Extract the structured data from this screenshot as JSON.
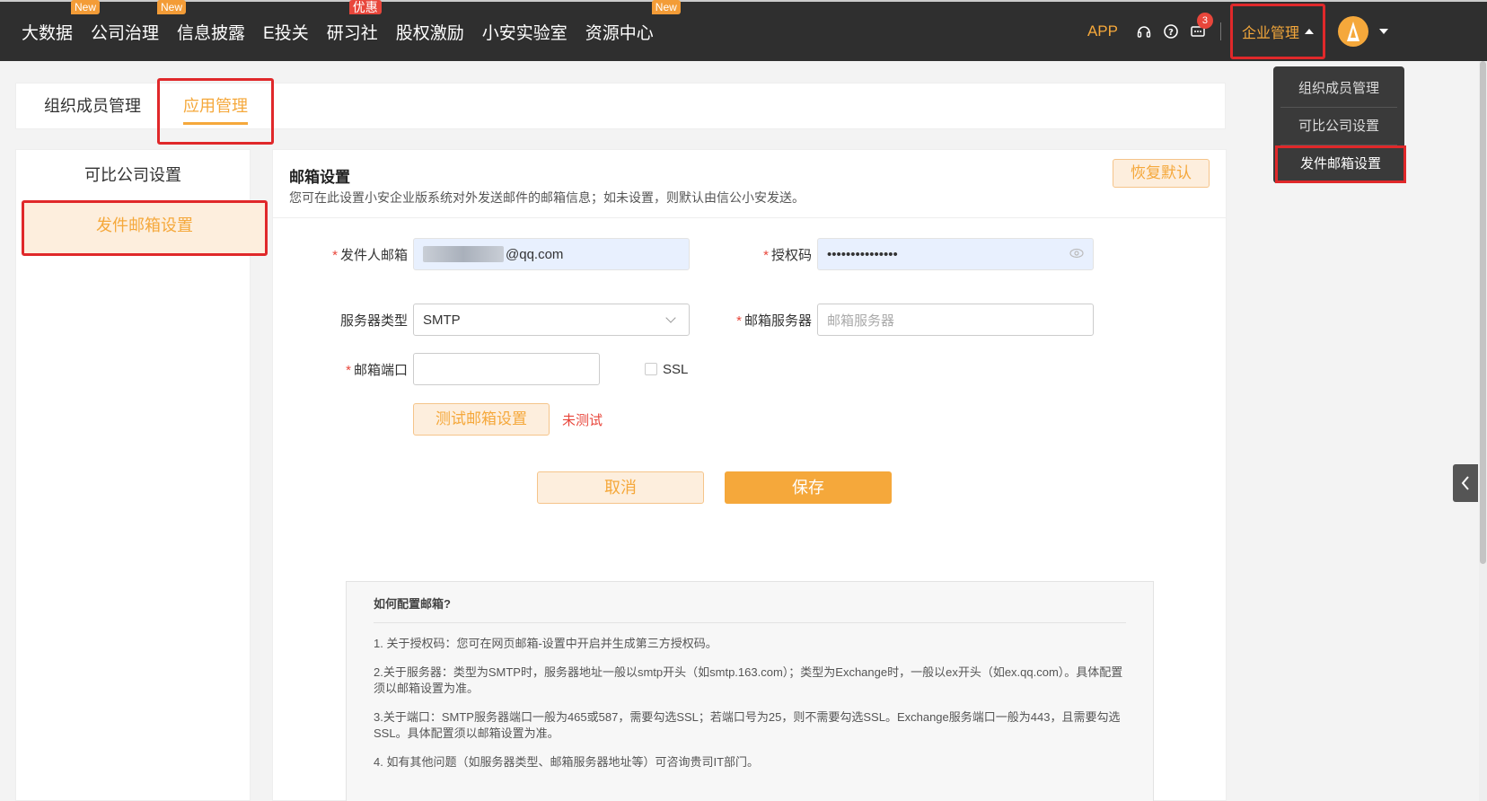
{
  "nav": {
    "items": [
      {
        "label": "大数据",
        "badge": "New"
      },
      {
        "label": "公司治理",
        "badge": "New"
      },
      {
        "label": "信息披露",
        "badge": ""
      },
      {
        "label": "E投关",
        "badge": ""
      },
      {
        "label": "研习社",
        "badge": "优惠"
      },
      {
        "label": "股权激励",
        "badge": ""
      },
      {
        "label": "小安实验室",
        "badge": ""
      },
      {
        "label": "资源中心",
        "badge": "New"
      }
    ],
    "app_label": "APP",
    "message_count": "3",
    "enterprise_menu": "企业管理"
  },
  "dropdown": {
    "items": [
      "组织成员管理",
      "可比公司设置",
      "发件邮箱设置"
    ]
  },
  "tabs": [
    "组织成员管理",
    "应用管理"
  ],
  "sidebar": {
    "items": [
      "可比公司设置",
      "发件邮箱设置"
    ]
  },
  "main": {
    "title": "邮箱设置",
    "description": "您可在此设置小安企业版系统对外发送邮件的邮箱信息；如未设置，则默认由信公小安发送。",
    "restore_label": "恢复默认"
  },
  "form": {
    "sender_label": "发件人邮箱",
    "sender_value": "@qq.com",
    "auth_label": "授权码",
    "auth_value": "•••••••••••••••",
    "server_type_label": "服务器类型",
    "server_type_value": "SMTP",
    "mail_server_label": "邮箱服务器",
    "mail_server_placeholder": "邮箱服务器",
    "port_label": "邮箱端口",
    "port_value": "",
    "ssl_label": "SSL",
    "test_label": "测试邮箱设置",
    "test_status": "未测试",
    "cancel_label": "取消",
    "save_label": "保存"
  },
  "help": {
    "title": "如何配置邮箱?",
    "lines": [
      "1. 关于授权码：您可在网页邮箱-设置中开启并生成第三方授权码。",
      "2.关于服务器：类型为SMTP时，服务器地址一般以smtp开头（如smtp.163.com）；类型为Exchange时，一般以ex开头（如ex.qq.com）。具体配置须以邮箱设置为准。",
      "3.关于端口：SMTP服务器端口一般为465或587，需要勾选SSL；若端口号为25，则不需要勾选SSL。Exchange服务端口一般为443，且需要勾选SSL。具体配置须以邮箱设置为准。",
      "4. 如有其他问题（如服务器类型、邮箱服务器地址等）可咨询贵司IT部门。"
    ]
  },
  "colors": {
    "accent": "#f5a83b",
    "highlight": "#e0282a",
    "topbar": "#2f2f2f"
  }
}
